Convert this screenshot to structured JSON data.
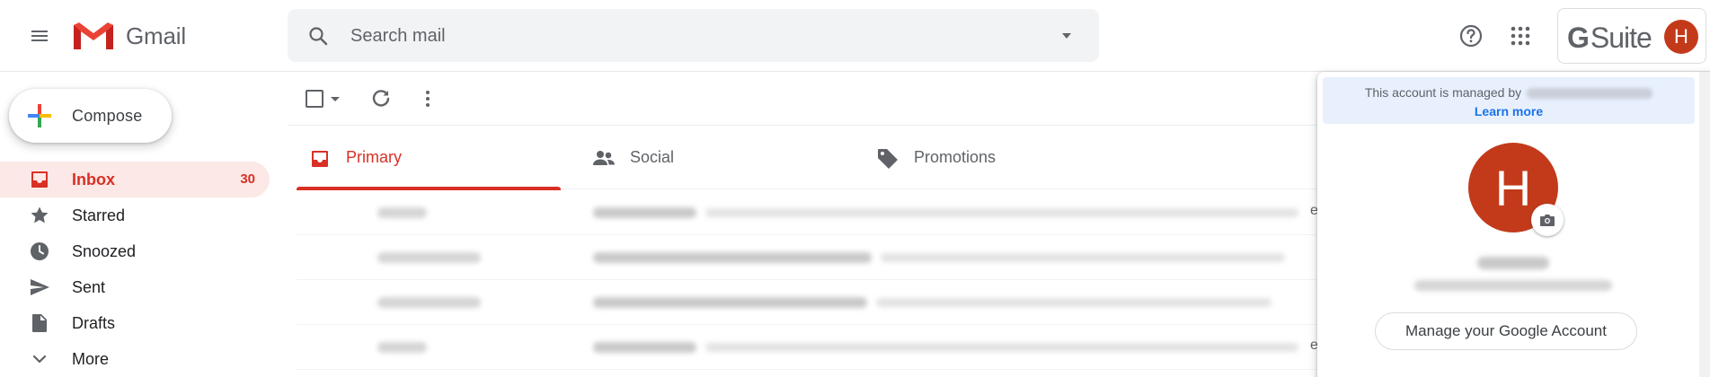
{
  "app": {
    "name": "Gmail"
  },
  "search": {
    "placeholder": "Search mail"
  },
  "header": {
    "gsuite_label": "Suite",
    "gsuite_g": "G",
    "avatar_initial": "H"
  },
  "compose": {
    "label": "Compose"
  },
  "nav": {
    "items": [
      {
        "label": "Inbox",
        "count": "30",
        "icon": "inbox-icon"
      },
      {
        "label": "Starred",
        "icon": "star-icon"
      },
      {
        "label": "Snoozed",
        "icon": "clock-icon"
      },
      {
        "label": "Sent",
        "icon": "send-icon"
      },
      {
        "label": "Drafts",
        "icon": "draft-icon"
      },
      {
        "label": "More",
        "icon": "chevron-down-icon"
      }
    ]
  },
  "tabs": [
    {
      "label": "Primary",
      "icon": "inbox-icon"
    },
    {
      "label": "Social",
      "icon": "people-icon"
    },
    {
      "label": "Promotions",
      "icon": "tag-icon"
    }
  ],
  "account_popup": {
    "managed_text": "This account is managed by",
    "learn_more": "Learn more",
    "avatar_initial": "H",
    "manage_button": "Manage your Google Account"
  },
  "colors": {
    "accent_red": "#d93025",
    "avatar_bg": "#c33a1b",
    "active_nav_bg": "#fce8e6",
    "link_blue": "#1a73e8"
  }
}
